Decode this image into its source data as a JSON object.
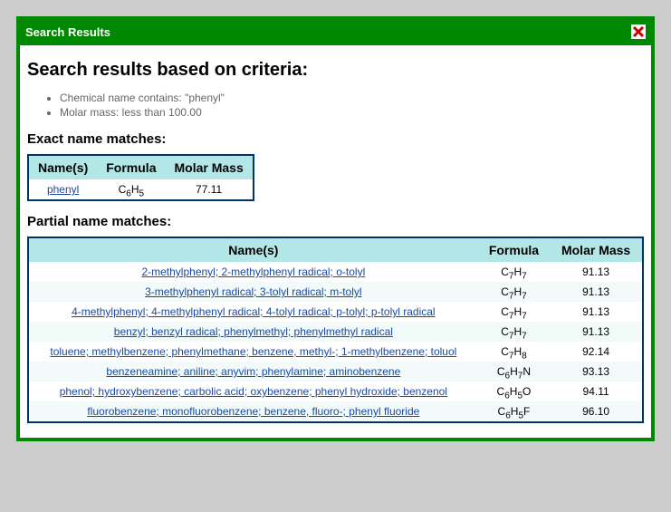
{
  "titlebar": {
    "text": "Search Results"
  },
  "heading": "Search results based on criteria:",
  "criteria": [
    "Chemical name contains: \"phenyl\"",
    "Molar mass: less than 100.00"
  ],
  "exact": {
    "heading": "Exact name matches:",
    "headers": [
      "Name(s)",
      "Formula",
      "Molar Mass"
    ],
    "rows": [
      {
        "name": "phenyl",
        "formula_html": "C<sub>6</sub>H<sub>5</sub>",
        "mass": "77.11"
      }
    ]
  },
  "partial": {
    "heading": "Partial name matches:",
    "headers": [
      "Name(s)",
      "Formula",
      "Molar Mass"
    ],
    "rows": [
      {
        "name": "2-methylphenyl; 2-methylphenyl radical; o-tolyl",
        "formula_html": "C<sub>7</sub>H<sub>7</sub>",
        "mass": "91.13"
      },
      {
        "name": "3-methylphenyl radical; 3-tolyl radical; m-tolyl",
        "formula_html": "C<sub>7</sub>H<sub>7</sub>",
        "mass": "91.13"
      },
      {
        "name": "4-methylphenyl; 4-methylphenyl radical; 4-tolyl radical; p-tolyl; p-tolyl radical",
        "formula_html": "C<sub>7</sub>H<sub>7</sub>",
        "mass": "91.13"
      },
      {
        "name": "benzyl; benzyl radical; phenylmethyl; phenylmethyl radical",
        "formula_html": "C<sub>7</sub>H<sub>7</sub>",
        "mass": "91.13"
      },
      {
        "name": "toluene; methylbenzene; phenylmethane; benzene, methyl-; 1-methylbenzene; toluol",
        "formula_html": "C<sub>7</sub>H<sub>8</sub>",
        "mass": "92.14"
      },
      {
        "name": "benzeneamine; aniline; anyvim; phenylamine; aminobenzene",
        "formula_html": "C<sub>6</sub>H<sub>7</sub>N",
        "mass": "93.13"
      },
      {
        "name": "phenol; hydroxybenzene; carbolic acid; oxybenzene; phenyl hydroxide; benzenol",
        "formula_html": "C<sub>6</sub>H<sub>5</sub>O",
        "mass": "94.11"
      },
      {
        "name": "fluorobenzene; monofluorobenzene; benzene, fluoro-; phenyl fluoride",
        "formula_html": "C<sub>6</sub>H<sub>5</sub>F",
        "mass": "96.10"
      }
    ]
  }
}
